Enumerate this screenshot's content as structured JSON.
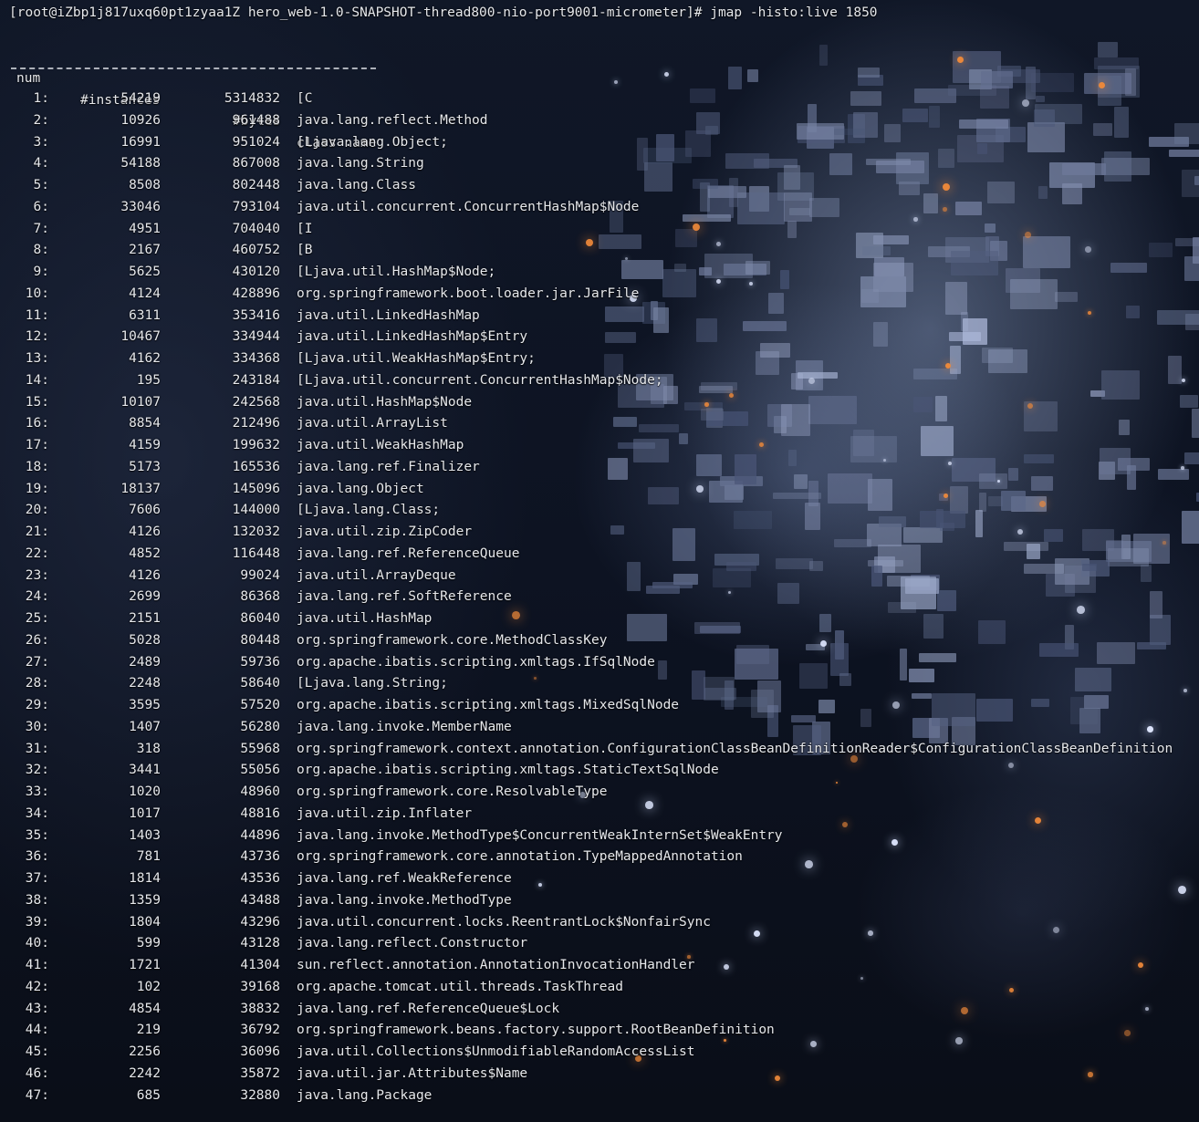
{
  "terminal": {
    "prompt": "[root@iZbp1j817uxq60pt1zyaa1Z hero_web-1.0-SNAPSHOT-thread800-nio-port9001-micrometer]# jmap -histo:live 1850",
    "headers": {
      "num": "num",
      "instances": "#instances",
      "bytes": "#bytes",
      "class_name": "class name"
    },
    "separator": "----------------------------------------------",
    "rows": [
      {
        "num": "1:",
        "instances": "54219",
        "bytes": "5314832",
        "class_name": "[C"
      },
      {
        "num": "2:",
        "instances": "10926",
        "bytes": "961488",
        "class_name": "java.lang.reflect.Method"
      },
      {
        "num": "3:",
        "instances": "16991",
        "bytes": "951024",
        "class_name": "[Ljava.lang.Object;"
      },
      {
        "num": "4:",
        "instances": "54188",
        "bytes": "867008",
        "class_name": "java.lang.String"
      },
      {
        "num": "5:",
        "instances": "8508",
        "bytes": "802448",
        "class_name": "java.lang.Class"
      },
      {
        "num": "6:",
        "instances": "33046",
        "bytes": "793104",
        "class_name": "java.util.concurrent.ConcurrentHashMap$Node"
      },
      {
        "num": "7:",
        "instances": "4951",
        "bytes": "704040",
        "class_name": "[I"
      },
      {
        "num": "8:",
        "instances": "2167",
        "bytes": "460752",
        "class_name": "[B"
      },
      {
        "num": "9:",
        "instances": "5625",
        "bytes": "430120",
        "class_name": "[Ljava.util.HashMap$Node;"
      },
      {
        "num": "10:",
        "instances": "4124",
        "bytes": "428896",
        "class_name": "org.springframework.boot.loader.jar.JarFile"
      },
      {
        "num": "11:",
        "instances": "6311",
        "bytes": "353416",
        "class_name": "java.util.LinkedHashMap"
      },
      {
        "num": "12:",
        "instances": "10467",
        "bytes": "334944",
        "class_name": "java.util.LinkedHashMap$Entry"
      },
      {
        "num": "13:",
        "instances": "4162",
        "bytes": "334368",
        "class_name": "[Ljava.util.WeakHashMap$Entry;"
      },
      {
        "num": "14:",
        "instances": "195",
        "bytes": "243184",
        "class_name": "[Ljava.util.concurrent.ConcurrentHashMap$Node;"
      },
      {
        "num": "15:",
        "instances": "10107",
        "bytes": "242568",
        "class_name": "java.util.HashMap$Node"
      },
      {
        "num": "16:",
        "instances": "8854",
        "bytes": "212496",
        "class_name": "java.util.ArrayList"
      },
      {
        "num": "17:",
        "instances": "4159",
        "bytes": "199632",
        "class_name": "java.util.WeakHashMap"
      },
      {
        "num": "18:",
        "instances": "5173",
        "bytes": "165536",
        "class_name": "java.lang.ref.Finalizer"
      },
      {
        "num": "19:",
        "instances": "18137",
        "bytes": "145096",
        "class_name": "java.lang.Object"
      },
      {
        "num": "20:",
        "instances": "7606",
        "bytes": "144000",
        "class_name": "[Ljava.lang.Class;"
      },
      {
        "num": "21:",
        "instances": "4126",
        "bytes": "132032",
        "class_name": "java.util.zip.ZipCoder"
      },
      {
        "num": "22:",
        "instances": "4852",
        "bytes": "116448",
        "class_name": "java.lang.ref.ReferenceQueue"
      },
      {
        "num": "23:",
        "instances": "4126",
        "bytes": "99024",
        "class_name": "java.util.ArrayDeque"
      },
      {
        "num": "24:",
        "instances": "2699",
        "bytes": "86368",
        "class_name": "java.lang.ref.SoftReference"
      },
      {
        "num": "25:",
        "instances": "2151",
        "bytes": "86040",
        "class_name": "java.util.HashMap"
      },
      {
        "num": "26:",
        "instances": "5028",
        "bytes": "80448",
        "class_name": "org.springframework.core.MethodClassKey"
      },
      {
        "num": "27:",
        "instances": "2489",
        "bytes": "59736",
        "class_name": "org.apache.ibatis.scripting.xmltags.IfSqlNode"
      },
      {
        "num": "28:",
        "instances": "2248",
        "bytes": "58640",
        "class_name": "[Ljava.lang.String;"
      },
      {
        "num": "29:",
        "instances": "3595",
        "bytes": "57520",
        "class_name": "org.apache.ibatis.scripting.xmltags.MixedSqlNode"
      },
      {
        "num": "30:",
        "instances": "1407",
        "bytes": "56280",
        "class_name": "java.lang.invoke.MemberName"
      },
      {
        "num": "31:",
        "instances": "318",
        "bytes": "55968",
        "class_name": "org.springframework.context.annotation.ConfigurationClassBeanDefinitionReader$ConfigurationClassBeanDefinition"
      },
      {
        "num": "32:",
        "instances": "3441",
        "bytes": "55056",
        "class_name": "org.apache.ibatis.scripting.xmltags.StaticTextSqlNode"
      },
      {
        "num": "33:",
        "instances": "1020",
        "bytes": "48960",
        "class_name": "org.springframework.core.ResolvableType"
      },
      {
        "num": "34:",
        "instances": "1017",
        "bytes": "48816",
        "class_name": "java.util.zip.Inflater"
      },
      {
        "num": "35:",
        "instances": "1403",
        "bytes": "44896",
        "class_name": "java.lang.invoke.MethodType$ConcurrentWeakInternSet$WeakEntry"
      },
      {
        "num": "36:",
        "instances": "781",
        "bytes": "43736",
        "class_name": "org.springframework.core.annotation.TypeMappedAnnotation"
      },
      {
        "num": "37:",
        "instances": "1814",
        "bytes": "43536",
        "class_name": "java.lang.ref.WeakReference"
      },
      {
        "num": "38:",
        "instances": "1359",
        "bytes": "43488",
        "class_name": "java.lang.invoke.MethodType"
      },
      {
        "num": "39:",
        "instances": "1804",
        "bytes": "43296",
        "class_name": "java.util.concurrent.locks.ReentrantLock$NonfairSync"
      },
      {
        "num": "40:",
        "instances": "599",
        "bytes": "43128",
        "class_name": "java.lang.reflect.Constructor"
      },
      {
        "num": "41:",
        "instances": "1721",
        "bytes": "41304",
        "class_name": "sun.reflect.annotation.AnnotationInvocationHandler"
      },
      {
        "num": "42:",
        "instances": "102",
        "bytes": "39168",
        "class_name": "org.apache.tomcat.util.threads.TaskThread"
      },
      {
        "num": "43:",
        "instances": "4854",
        "bytes": "38832",
        "class_name": "java.lang.ref.ReferenceQueue$Lock"
      },
      {
        "num": "44:",
        "instances": "219",
        "bytes": "36792",
        "class_name": "org.springframework.beans.factory.support.RootBeanDefinition"
      },
      {
        "num": "45:",
        "instances": "2256",
        "bytes": "36096",
        "class_name": "java.util.Collections$UnmodifiableRandomAccessList"
      },
      {
        "num": "46:",
        "instances": "2242",
        "bytes": "35872",
        "class_name": "java.util.jar.Attributes$Name"
      },
      {
        "num": "47:",
        "instances": "685",
        "bytes": "32880",
        "class_name": "java.lang.Package"
      }
    ]
  },
  "theme": {
    "text_color": "#e6e8ec",
    "background_color": "#0b0f1a",
    "accent_spark": "#f08a3a"
  }
}
